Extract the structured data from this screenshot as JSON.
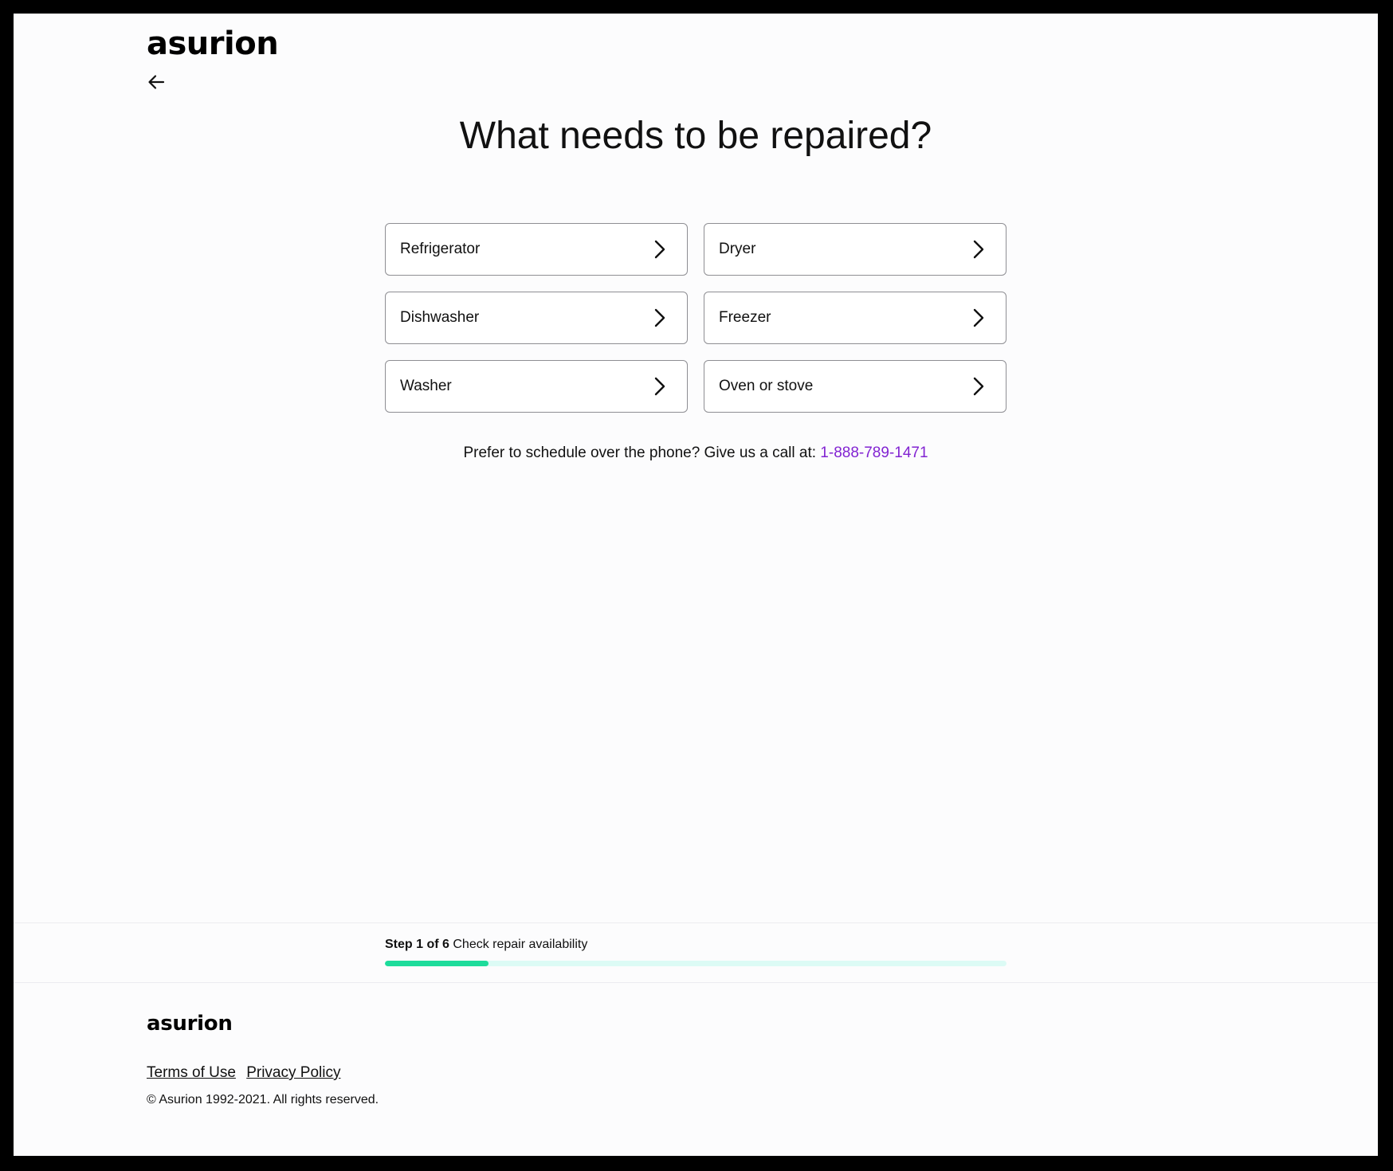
{
  "header": {
    "logo_text": "asurion"
  },
  "main": {
    "title": "What needs to be repaired?",
    "options": [
      {
        "label": "Refrigerator"
      },
      {
        "label": "Dryer"
      },
      {
        "label": "Dishwasher"
      },
      {
        "label": "Freezer"
      },
      {
        "label": "Washer"
      },
      {
        "label": "Oven or stove"
      }
    ],
    "phone_prompt": "Prefer to schedule over the phone? Give us a call at:",
    "phone_number": "1-888-789-1471"
  },
  "progress": {
    "step_label": "Step 1 of 6",
    "step_description": "Check repair availability",
    "current_step": 1,
    "total_steps": 6,
    "fraction": 0.1667
  },
  "footer": {
    "logo_text": "asurion",
    "links": [
      {
        "label": "Terms of Use"
      },
      {
        "label": "Privacy Policy"
      }
    ],
    "copyright": "© Asurion 1992-2021. All rights reserved."
  },
  "icons": {
    "back": "arrow-left-icon",
    "chevron": "chevron-right-icon"
  },
  "colors": {
    "accent_link": "#8223d2",
    "progress_fill": "#1ddc9b",
    "progress_track": "#dcfbf5",
    "background": "#fcfcfd"
  }
}
